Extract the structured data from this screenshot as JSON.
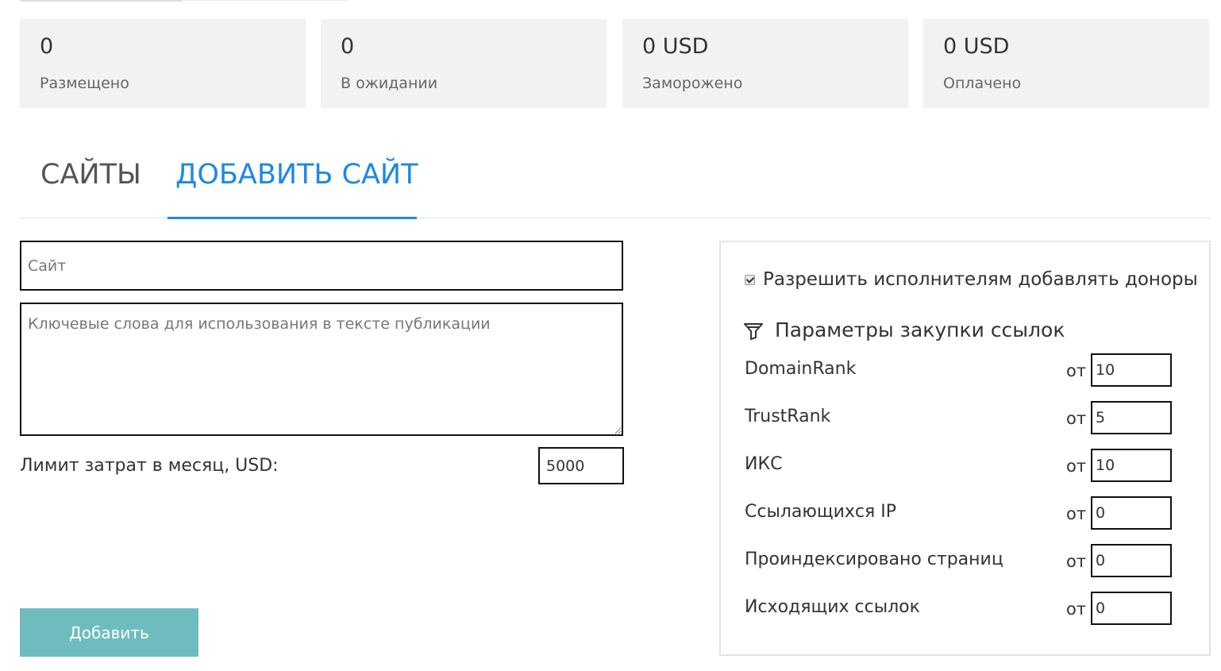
{
  "stats": [
    {
      "value": "0",
      "label": "Размещено"
    },
    {
      "value": "0",
      "label": "В ожидании"
    },
    {
      "value": "0 USD",
      "label": "Заморожено"
    },
    {
      "value": "0 USD",
      "label": "Оплачено"
    }
  ],
  "tabs": [
    {
      "label": "САЙТЫ",
      "active": false
    },
    {
      "label": "ДОБАВИТЬ САЙТ",
      "active": true
    }
  ],
  "form": {
    "site_placeholder": "Сайт",
    "site_value": "",
    "keywords_placeholder": "Ключевые слова для использования в тексте публикации",
    "keywords_value": "",
    "limit_label": "Лимит затрат в месяц, USD:",
    "limit_value": "5000",
    "submit_label": "Добавить"
  },
  "panel": {
    "allow_donors_label": "Разрешить исполнителям добавлять доноры",
    "allow_donors_checked": true,
    "params_title": "Параметры закупки ссылок",
    "params_icon": "funnel-icon",
    "params": [
      {
        "label": "DomainRank",
        "from_label": "от",
        "value": "10"
      },
      {
        "label": "TrustRank",
        "from_label": "от",
        "value": "5"
      },
      {
        "label": "ИКС",
        "from_label": "от",
        "value": "10"
      },
      {
        "label": "Ссылающихся IP",
        "from_label": "от",
        "value": "0"
      },
      {
        "label": "Проиндексировано страниц",
        "from_label": "от",
        "value": "0"
      },
      {
        "label": "Исходящих ссылок",
        "from_label": "от",
        "value": "0"
      }
    ]
  },
  "colors": {
    "accent": "#1e88e5",
    "button": "#6fbcbf",
    "card_bg": "#f2f2f2"
  }
}
